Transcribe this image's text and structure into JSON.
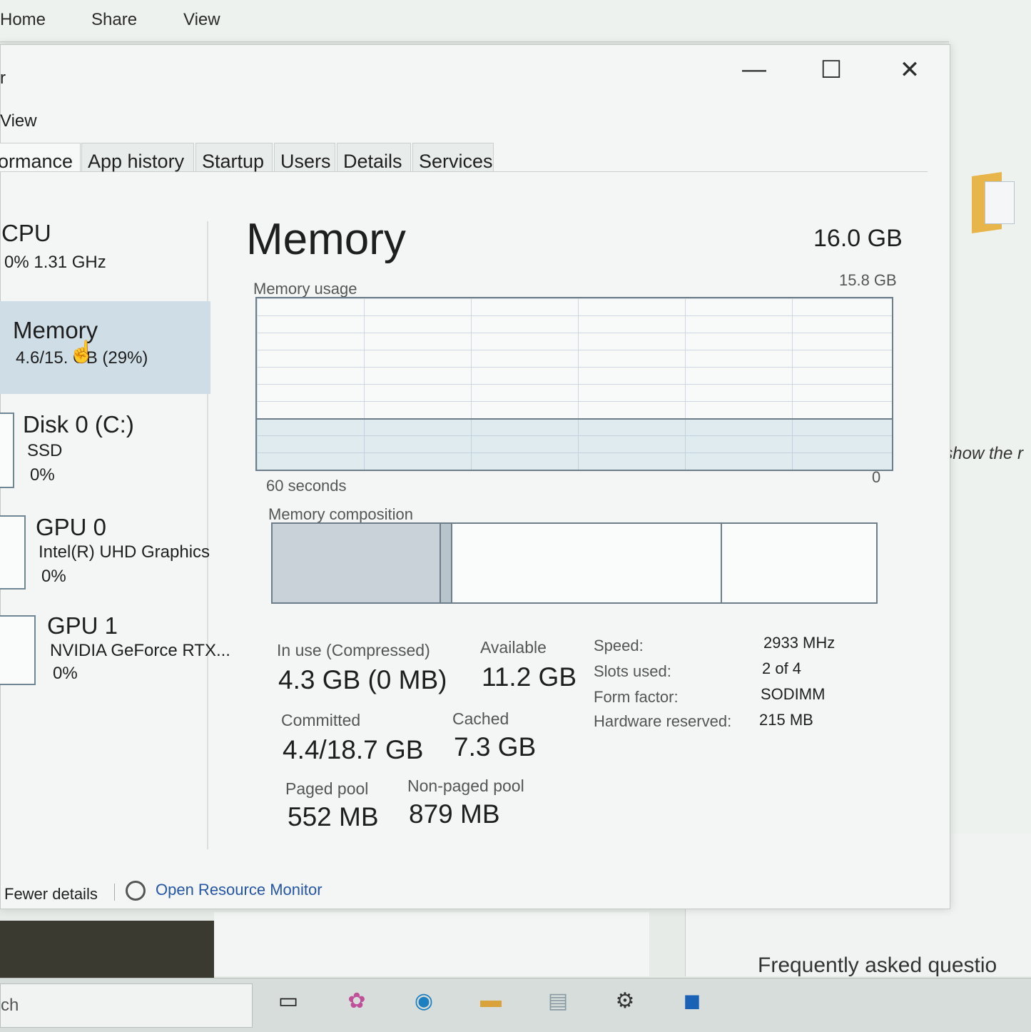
{
  "background": {
    "ribbon_tabs": [
      "Home",
      "Share",
      "View"
    ],
    "side_text": "e'll show the r",
    "faq_text": "Frequently asked questio",
    "search_text": "ch"
  },
  "window": {
    "title_fragment": "r",
    "menu_fragment": "View",
    "controls": {
      "minimize": "—",
      "maximize": "☐",
      "close": "✕"
    }
  },
  "tabs": [
    {
      "label": "ormance"
    },
    {
      "label": "App history"
    },
    {
      "label": "Startup"
    },
    {
      "label": "Users"
    },
    {
      "label": "Details"
    },
    {
      "label": "Services"
    }
  ],
  "sidebar": {
    "cpu": {
      "title": "CPU",
      "sub": "0%  1.31 GHz"
    },
    "memory": {
      "title": "Memory",
      "sub": "4.6/15.   GB (29%)"
    },
    "disk": {
      "title": "Disk 0 (C:)",
      "sub1": "SSD",
      "sub2": "0%"
    },
    "gpu0": {
      "title": "GPU 0",
      "sub1": "Intel(R) UHD Graphics",
      "sub2": "0%"
    },
    "gpu1": {
      "title": "GPU 1",
      "sub1": "NVIDIA GeForce RTX...",
      "sub2": "0%"
    }
  },
  "main": {
    "title": "Memory",
    "total": "16.0 GB",
    "usage_label": "Memory usage",
    "usage_max": "15.8 GB",
    "time_left": "60 seconds",
    "time_right": "0",
    "composition_label": "Memory composition",
    "usage_fraction": 0.29
  },
  "stats": {
    "in_use_label": "In use (Compressed)",
    "in_use_value": "4.3 GB (0 MB)",
    "available_label": "Available",
    "available_value": "11.2 GB",
    "committed_label": "Committed",
    "committed_value": "4.4/18.7 GB",
    "cached_label": "Cached",
    "cached_value": "7.3 GB",
    "paged_label": "Paged pool",
    "paged_value": "552 MB",
    "nonpaged_label": "Non-paged pool",
    "nonpaged_value": "879 MB"
  },
  "details": [
    {
      "label": "Speed:",
      "value": "2933 MHz"
    },
    {
      "label": "Slots used:",
      "value": "2 of 4"
    },
    {
      "label": "Form factor:",
      "value": "SODIMM"
    },
    {
      "label": "Hardware reserved:",
      "value": "215 MB"
    }
  ],
  "footer": {
    "fewer_details": "Fewer details",
    "open_resource_monitor": "Open Resource Monitor"
  },
  "taskbar": {
    "icons": [
      "task-view-icon",
      "copilot-icon",
      "edge-icon",
      "file-explorer-icon",
      "photos-icon",
      "settings-icon",
      "outlook-icon"
    ]
  }
}
